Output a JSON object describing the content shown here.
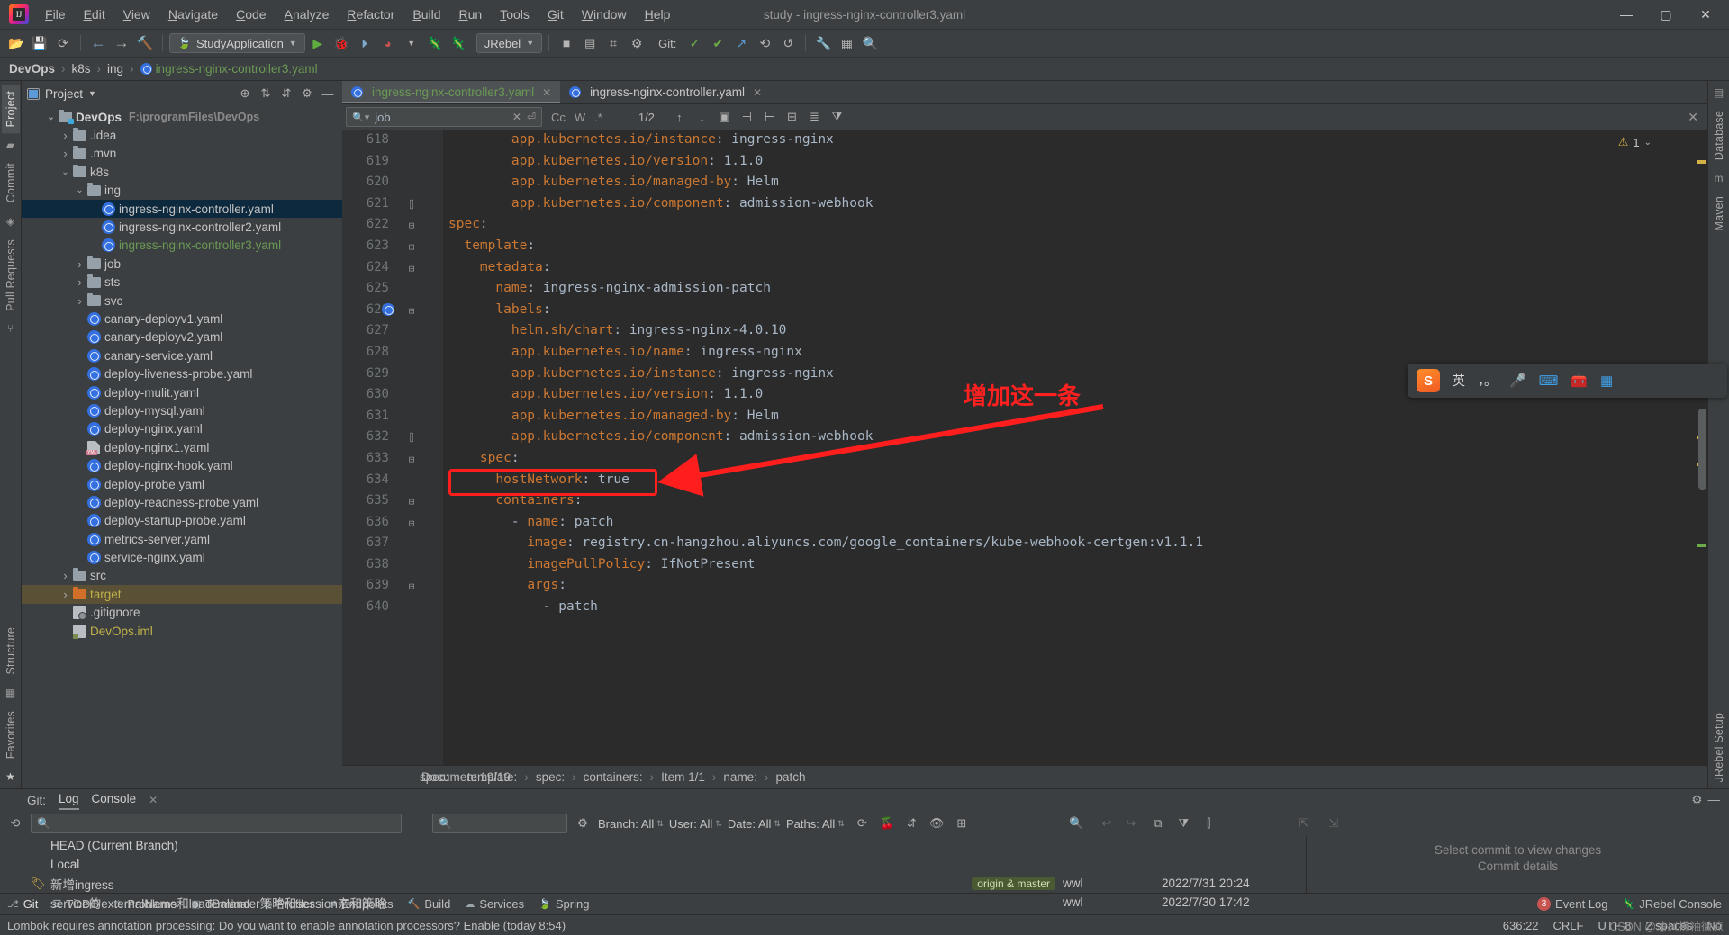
{
  "window": {
    "title": "study - ingress-nginx-controller3.yaml",
    "minimize": "—",
    "maximize": "▢",
    "close": "✕"
  },
  "menubar": [
    {
      "label": "File"
    },
    {
      "label": "Edit"
    },
    {
      "label": "View"
    },
    {
      "label": "Navigate"
    },
    {
      "label": "Code"
    },
    {
      "label": "Analyze"
    },
    {
      "label": "Refactor"
    },
    {
      "label": "Build"
    },
    {
      "label": "Run"
    },
    {
      "label": "Tools"
    },
    {
      "label": "Git"
    },
    {
      "label": "Window"
    },
    {
      "label": "Help"
    }
  ],
  "toolbar": {
    "run_config": "StudyApplication",
    "jrebel": "JRebel",
    "git_label": "Git:"
  },
  "navbar": {
    "crumbs": [
      "DevOps",
      "k8s",
      "ing",
      "ingress-nginx-controller3.yaml"
    ]
  },
  "left_rail": {
    "tabs": [
      "Project",
      "Commit",
      "Pull Requests",
      "Structure",
      "Favorites"
    ]
  },
  "right_rail": {
    "tabs": [
      "Database",
      "Maven",
      "JRebel Setup"
    ]
  },
  "project_panel": {
    "title": "Project",
    "tree": [
      {
        "indent": 0,
        "twisty": "v",
        "icon": "folder-module",
        "name": "DevOps",
        "path": "F:\\programFiles\\DevOps",
        "bold": true
      },
      {
        "indent": 1,
        "twisty": ">",
        "icon": "folder",
        "name": ".idea"
      },
      {
        "indent": 1,
        "twisty": ">",
        "icon": "folder",
        "name": ".mvn"
      },
      {
        "indent": 1,
        "twisty": "v",
        "icon": "folder",
        "name": "k8s"
      },
      {
        "indent": 2,
        "twisty": "v",
        "icon": "folder",
        "name": "ing"
      },
      {
        "indent": 3,
        "twisty": "",
        "icon": "k8s",
        "name": "ingress-nginx-controller.yaml",
        "selected": true
      },
      {
        "indent": 3,
        "twisty": "",
        "icon": "k8s",
        "name": "ingress-nginx-controller2.yaml"
      },
      {
        "indent": 3,
        "twisty": "",
        "icon": "k8s",
        "name": "ingress-nginx-controller3.yaml",
        "green": true
      },
      {
        "indent": 2,
        "twisty": ">",
        "icon": "folder",
        "name": "job"
      },
      {
        "indent": 2,
        "twisty": ">",
        "icon": "folder",
        "name": "sts"
      },
      {
        "indent": 2,
        "twisty": ">",
        "icon": "folder",
        "name": "svc"
      },
      {
        "indent": 2,
        "twisty": "",
        "icon": "k8s",
        "name": "canary-deployv1.yaml"
      },
      {
        "indent": 2,
        "twisty": "",
        "icon": "k8s",
        "name": "canary-deployv2.yaml"
      },
      {
        "indent": 2,
        "twisty": "",
        "icon": "k8s",
        "name": "canary-service.yaml"
      },
      {
        "indent": 2,
        "twisty": "",
        "icon": "k8s",
        "name": "deploy-liveness-probe.yaml"
      },
      {
        "indent": 2,
        "twisty": "",
        "icon": "k8s",
        "name": "deploy-mulit.yaml"
      },
      {
        "indent": 2,
        "twisty": "",
        "icon": "k8s",
        "name": "deploy-mysql.yaml"
      },
      {
        "indent": 2,
        "twisty": "",
        "icon": "k8s",
        "name": "deploy-nginx.yaml"
      },
      {
        "indent": 2,
        "twisty": "",
        "icon": "yml",
        "name": "deploy-nginx1.yaml"
      },
      {
        "indent": 2,
        "twisty": "",
        "icon": "k8s",
        "name": "deploy-nginx-hook.yaml"
      },
      {
        "indent": 2,
        "twisty": "",
        "icon": "k8s",
        "name": "deploy-probe.yaml"
      },
      {
        "indent": 2,
        "twisty": "",
        "icon": "k8s",
        "name": "deploy-readness-probe.yaml"
      },
      {
        "indent": 2,
        "twisty": "",
        "icon": "k8s",
        "name": "deploy-startup-probe.yaml"
      },
      {
        "indent": 2,
        "twisty": "",
        "icon": "k8s",
        "name": "metrics-server.yaml"
      },
      {
        "indent": 2,
        "twisty": "",
        "icon": "k8s",
        "name": "service-nginx.yaml"
      },
      {
        "indent": 1,
        "twisty": ">",
        "icon": "folder",
        "name": "src"
      },
      {
        "indent": 1,
        "twisty": ">",
        "icon": "folder-orange",
        "name": "target",
        "target": true
      },
      {
        "indent": 1,
        "twisty": "",
        "icon": "gitignore",
        "name": ".gitignore"
      },
      {
        "indent": 1,
        "twisty": "",
        "icon": "iml",
        "name": "DevOps.iml",
        "yellow": true
      }
    ]
  },
  "editor": {
    "tabs": [
      {
        "label": "ingress-nginx-controller3.yaml",
        "active": true,
        "green": true
      },
      {
        "label": "ingress-nginx-controller.yaml",
        "active": false,
        "green": false
      }
    ],
    "find": {
      "value": "job",
      "match_case": "Cc",
      "words": "W",
      "regex": ".*",
      "count": "1/2"
    },
    "warnings": "1",
    "lines": [
      {
        "num": "618",
        "indent": 4,
        "key": "app.kubernetes.io/instance",
        "value": "ingress-nginx"
      },
      {
        "num": "619",
        "indent": 4,
        "key": "app.kubernetes.io/version",
        "value": "1.1.0"
      },
      {
        "num": "620",
        "indent": 4,
        "key": "app.kubernetes.io/managed-by",
        "value": "Helm"
      },
      {
        "num": "621",
        "indent": 4,
        "key": "app.kubernetes.io/component",
        "value": "admission-webhook",
        "fold": "up"
      },
      {
        "num": "622",
        "indent": 0,
        "key": "spec",
        "value": "",
        "fold": "down"
      },
      {
        "num": "623",
        "indent": 1,
        "key": "template",
        "value": "",
        "fold": "down"
      },
      {
        "num": "624",
        "indent": 2,
        "key": "metadata",
        "value": "",
        "fold": "down"
      },
      {
        "num": "625",
        "indent": 3,
        "key": "name",
        "value": "ingress-nginx-admission-patch"
      },
      {
        "num": "626",
        "indent": 3,
        "key": "labels",
        "value": "",
        "fold": "down",
        "gutter_icon": "k8s"
      },
      {
        "num": "627",
        "indent": 4,
        "key": "helm.sh/chart",
        "value": "ingress-nginx-4.0.10"
      },
      {
        "num": "628",
        "indent": 4,
        "key": "app.kubernetes.io/name",
        "value": "ingress-nginx"
      },
      {
        "num": "629",
        "indent": 4,
        "key": "app.kubernetes.io/instance",
        "value": "ingress-nginx"
      },
      {
        "num": "630",
        "indent": 4,
        "key": "app.kubernetes.io/version",
        "value": "1.1.0"
      },
      {
        "num": "631",
        "indent": 4,
        "key": "app.kubernetes.io/managed-by",
        "value": "Helm"
      },
      {
        "num": "632",
        "indent": 4,
        "key": "app.kubernetes.io/component",
        "value": "admission-webhook",
        "fold": "up"
      },
      {
        "num": "633",
        "indent": 2,
        "key": "spec",
        "value": "",
        "fold": "down"
      },
      {
        "num": "634",
        "indent": 3,
        "key": "hostNetwork",
        "value": "true",
        "highlight": true
      },
      {
        "num": "635",
        "indent": 3,
        "key": "containers",
        "value": "",
        "fold": "down"
      },
      {
        "num": "636",
        "indent": 4,
        "dash": true,
        "key": "name",
        "value": "patch",
        "fold": "down"
      },
      {
        "num": "637",
        "indent": 5,
        "key": "image",
        "value": "registry.cn-hangzhou.aliyuncs.com/google_containers/kube-webhook-certgen:v1.1.1"
      },
      {
        "num": "638",
        "indent": 5,
        "key": "imagePullPolicy",
        "value": "IfNotPresent"
      },
      {
        "num": "639",
        "indent": 5,
        "key": "args",
        "value": "",
        "fold": "down"
      },
      {
        "num": "640",
        "indent": 6,
        "dash": true,
        "key": "",
        "value": "patch",
        "plain": true
      }
    ],
    "annotation": "增加这一条",
    "breadcrumb": [
      "spec:",
      "template:",
      "spec:",
      "containers:",
      "Item 1/1",
      "name:",
      "patch"
    ],
    "document_status": "Document 19/19"
  },
  "git_window": {
    "label": "Git:",
    "tabs": [
      {
        "label": "Log",
        "active": true
      },
      {
        "label": "Console",
        "active": false
      }
    ],
    "search_placeholder": "",
    "filters": [
      {
        "label": "Branch:",
        "value": "All"
      },
      {
        "label": "User:",
        "value": "All"
      },
      {
        "label": "Date:",
        "value": "All"
      },
      {
        "label": "Paths:",
        "value": "All"
      }
    ],
    "commits": [
      {
        "message": "HEAD (Current Branch)",
        "tag": "",
        "author": "",
        "date": "",
        "head": true
      },
      {
        "message": "Local",
        "tag": "",
        "author": "",
        "date": "",
        "head": true
      },
      {
        "message": "新增ingress",
        "tag": "origin & master",
        "author": "wwl",
        "date": "2022/7/31 20:24"
      },
      {
        "message": "service的externalName和loadBalancer策略和session亲和策略",
        "tag": "",
        "author": "wwl",
        "date": "2022/7/30 17:42"
      }
    ],
    "details_title": "Select commit to view changes",
    "details_sub": "Commit details"
  },
  "bottom_strip": {
    "left": [
      {
        "label": "Git",
        "icon": "git-icon",
        "active": true
      },
      {
        "label": "TODO",
        "icon": "todo-icon"
      },
      {
        "label": "Problems",
        "icon": "problems-icon"
      },
      {
        "label": "Terminal",
        "icon": "terminal-icon"
      },
      {
        "label": "Profiler",
        "icon": "profiler-icon"
      },
      {
        "label": "Endpoints",
        "icon": "endpoints-icon"
      },
      {
        "label": "Build",
        "icon": "build-icon"
      },
      {
        "label": "Services",
        "icon": "services-icon"
      },
      {
        "label": "Spring",
        "icon": "spring-icon"
      }
    ],
    "right": [
      {
        "label": "Event Log",
        "icon": "event-log-icon",
        "badge": "3"
      },
      {
        "label": "JRebel Console",
        "icon": "jrebel-icon"
      }
    ]
  },
  "statusbar": {
    "message": "Lombok requires annotation processing: Do you want to enable annotation processors? Enable (today 8:54)",
    "caret": "636:22",
    "line_sep": "CRLF",
    "encoding": "UTF-8",
    "indent": "2 spaces",
    "vcs": "No"
  },
  "ime": {
    "logo": "S",
    "lang": "英",
    "punct": "，。",
    "mic": "mic-icon",
    "keyboard": "keyboard-icon",
    "toolbox": "toolbox-icon",
    "grid": "grid-icon"
  },
  "watermark": "CSDN @清风拂袖微凉"
}
